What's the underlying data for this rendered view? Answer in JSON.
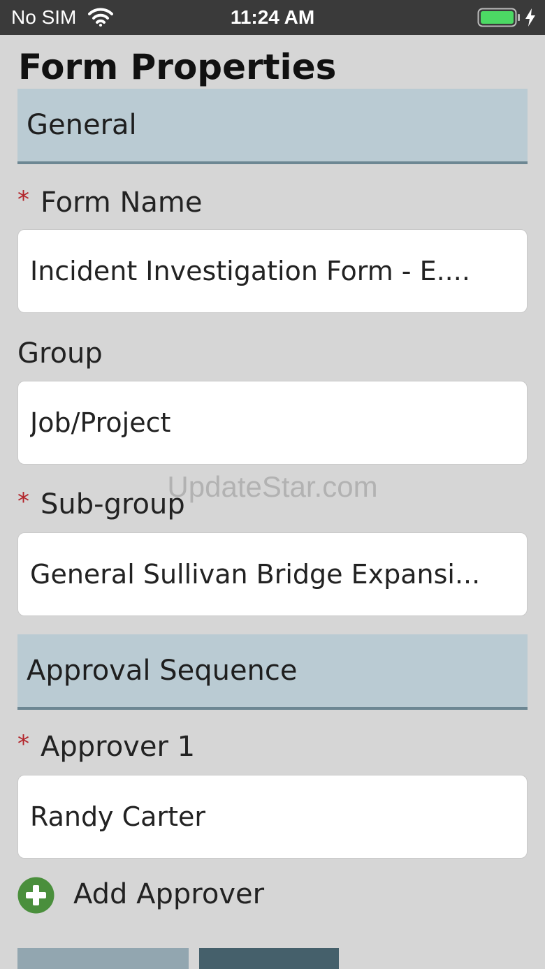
{
  "status_bar": {
    "carrier": "No SIM",
    "time": "11:24 AM",
    "wifi_icon": "wifi-icon",
    "battery_icon": "battery-charging-icon",
    "battery_color": "#4cd964"
  },
  "page": {
    "title": "Form Properties"
  },
  "sections": {
    "general": "General",
    "approval": "Approval Sequence"
  },
  "fields": {
    "form_name": {
      "label": "Form Name",
      "required": "*",
      "value": "Incident Investigation Form - E...."
    },
    "group": {
      "label": "Group",
      "value": "Job/Project"
    },
    "sub_group": {
      "label": "Sub-group",
      "required": "*",
      "value": "General Sullivan Bridge Expansi..."
    },
    "approver_1": {
      "label": "Approver 1",
      "required": "*",
      "value": "Randy Carter"
    }
  },
  "add_approver": {
    "label": "Add Approver",
    "icon": "plus-circle-icon",
    "icon_color": "#4a8f3c"
  },
  "watermark": "UpdateStar.com",
  "colors": {
    "background": "#d6d6d6",
    "section_header": "#bacbd3",
    "section_border": "#6d8793",
    "required": "#b3252b",
    "button_secondary": "#92a6b0",
    "button_primary": "#45606b"
  }
}
